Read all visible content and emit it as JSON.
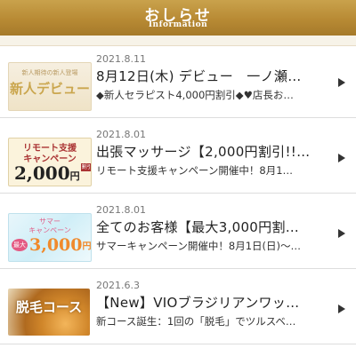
{
  "header": {
    "title": "おしらせ",
    "subtitle": "Information"
  },
  "items": [
    {
      "date": "2021.8.11",
      "title": "8月12日(木) デビュー　一ノ瀬…",
      "desc": "◆新人セラピスト4,000円割引◆♥店長お…",
      "thumb": {
        "small": "新人期待の新人登場",
        "main": "新人デビュー"
      }
    },
    {
      "date": "2021.8.01",
      "title": "出張マッサージ【2,000円割引!!…",
      "desc": "リモート支援キャンペーン開催中！8月1…",
      "thumb": {
        "line1": "リモート支援",
        "line2": "キャンペーン",
        "amount": "2,000",
        "unit": "円",
        "tag": "割引"
      }
    },
    {
      "date": "2021.8.01",
      "title": "全てのお客様【最大3,000円割…",
      "desc": "サマーキャンペーン開催中！8月1日(日)〜…",
      "thumb": {
        "line1": "サマー",
        "line2": "キャンペーン",
        "prefix": "最大",
        "amount": "3,000",
        "unit": "円"
      }
    },
    {
      "date": "2021.6.3",
      "title": "【New】VIOブラジリアンワッ…",
      "desc": "新コース誕生：1回の「脱毛」でツルスベ…",
      "thumb": {
        "main": "脱毛コース"
      }
    }
  ]
}
